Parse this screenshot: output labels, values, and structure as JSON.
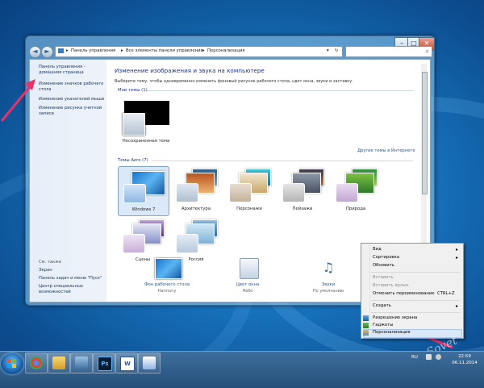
{
  "window": {
    "breadcrumbs": [
      "Панель управления",
      "Все элементы панели управления",
      "Персонализация"
    ],
    "search_placeholder": "",
    "close_glyph": "✕",
    "min_glyph": "–",
    "max_glyph": "□"
  },
  "left_pane": {
    "top_links": [
      "Панель управления -",
      "домашняя страница",
      "Изменение значков рабочего",
      "стола",
      "Изменение указателей мыши",
      "Изменение рисунка учетной",
      "записи"
    ],
    "see_also_header": "См. также",
    "see_also_links": [
      "Экран",
      "Панель задач и меню \"Пуск\"",
      "Центр специальных",
      "возможностей"
    ]
  },
  "main": {
    "heading": "Изменение изображения и звука на компьютере",
    "subtitle": "Выберите тему, чтобы одновременно изменить фоновый рисунок рабочего стола, цвет окна, звуки и заставку.",
    "my_themes_header": "Мои темы (1)",
    "unsaved_theme_label": "Несохраненная тема",
    "online_link": "Другие темы в Интернете",
    "aero_header": "Темы Aero (7)",
    "aero_themes": [
      "Windows 7",
      "Архитектура",
      "Персонажи",
      "Пейзажи",
      "Природа"
    ],
    "aero_themes_row2": [
      "Сцены",
      "Россия"
    ],
    "bottom_items": [
      {
        "title": "Фон рабочего стола",
        "sub": "Harmony"
      },
      {
        "title": "Цвет окна",
        "sub": "Небо"
      },
      {
        "title": "Звуки",
        "sub": "По умолчанию"
      }
    ]
  },
  "context_menu": {
    "items": [
      "Вид",
      "Сортировка",
      "Обновить",
      "Вставить",
      "Вставить ярлык",
      "Отменить переименование",
      "Создать",
      "Разрешение экрана",
      "Гаджеты",
      "Персонализация"
    ],
    "shortcut_undo": "CTRL+Z",
    "arrow_glyph": "▸"
  },
  "taskbar": {
    "language": "RU",
    "time": "22:59",
    "date": "06.11.2014"
  },
  "watermark": "Sovet",
  "colors": {
    "accent_link": "#1e5aa5",
    "heading": "#1e3287",
    "highlight": "#dbe8f7",
    "arrow_pink": "#e8336a"
  },
  "icons": [
    "back-icon",
    "forward-icon",
    "folder-icon",
    "search-icon",
    "close-icon",
    "chrome-icon",
    "explorer-icon",
    "photoshop-icon",
    "word-icon"
  ]
}
